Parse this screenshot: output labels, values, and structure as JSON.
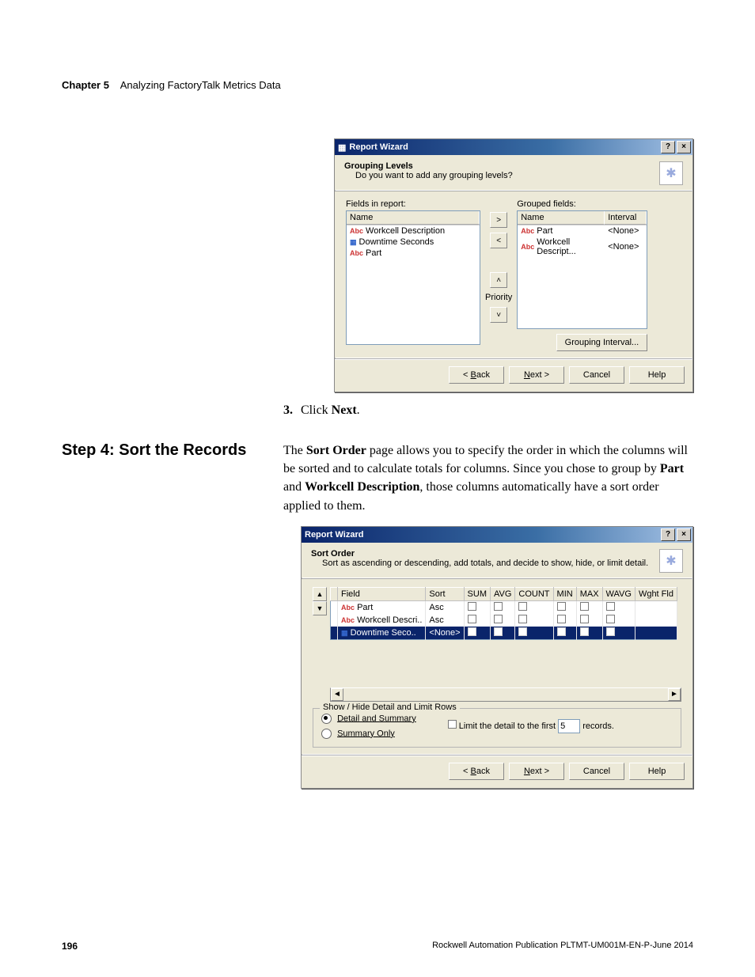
{
  "header": {
    "chapter": "Chapter 5",
    "title": "Analyzing FactoryTalk Metrics Data"
  },
  "section": {
    "number": "3.",
    "instruction_pre": "Click ",
    "instruction_bold": "Next",
    "instruction_post": "."
  },
  "step4": {
    "heading": "Step 4: Sort the Records",
    "para_parts": {
      "t1": "The ",
      "b1": "Sort Order",
      "t2": " page allows you to specify the order in which the columns will be sorted and to calculate totals for columns. Since you chose to group by ",
      "b2": "Part",
      "t3": " and ",
      "b3": "Workcell Description",
      "t4": ", those columns automatically have a sort order applied to them."
    }
  },
  "dlg1": {
    "title": "Report Wizard",
    "help_glyph": "?",
    "close_glyph": "×",
    "h1": "Grouping Levels",
    "sub": "Do you want to add any grouping levels?",
    "left_label": "Fields in report:",
    "left_header": "Name",
    "left_rows": [
      {
        "icon": "abc",
        "name": "Workcell Description"
      },
      {
        "icon": "num",
        "name": "Downtime Seconds"
      },
      {
        "icon": "abc",
        "name": "Part"
      }
    ],
    "right_label": "Grouped fields:",
    "right_headers": {
      "name": "Name",
      "interval": "Interval"
    },
    "right_rows": [
      {
        "icon": "abc",
        "name": "Part",
        "interval": "<None>"
      },
      {
        "icon": "abc",
        "name": "Workcell Descript...",
        "interval": "<None>"
      }
    ],
    "btn_right": ">",
    "btn_left": "<",
    "btn_up": "˄",
    "priority_label": "Priority",
    "btn_down": "˅",
    "grouping_interval": "Grouping Interval...",
    "footer": {
      "back": "< Back",
      "next": "Next >",
      "cancel": "Cancel",
      "help": "Help"
    }
  },
  "dlg2": {
    "title": "Report Wizard",
    "help_glyph": "?",
    "close_glyph": "×",
    "h1": "Sort Order",
    "sub": "Sort as ascending or descending, add totals, and decide to show, hide, or limit detail.",
    "spin_up": "▲",
    "spin_down": "▼",
    "cols": [
      "Field",
      "Sort",
      "SUM",
      "AVG",
      "COUNT",
      "MIN",
      "MAX",
      "WAVG",
      "Wght Fld"
    ],
    "rows": [
      {
        "icon": "abc",
        "field": "Part",
        "sort": "Asc",
        "sum": false,
        "avg": false,
        "count": false,
        "min": false,
        "max": false,
        "wavg": false,
        "sel": false
      },
      {
        "icon": "abc",
        "field": "Workcell Descri..",
        "sort": "Asc",
        "sum": false,
        "avg": false,
        "count": false,
        "min": false,
        "max": false,
        "wavg": false,
        "sel": false
      },
      {
        "icon": "num",
        "field": "Downtime Seco..",
        "sort": "<None>",
        "sum": false,
        "avg": true,
        "count": false,
        "min": false,
        "max": false,
        "wavg": false,
        "sel": true
      }
    ],
    "hscroll_left": "◄",
    "hscroll_right": "►",
    "fieldset_legend": "Show / Hide Detail and Limit Rows",
    "radio_detail": "Detail and Summary",
    "radio_summary": "Summary Only",
    "limit_checkbox_label_pre": "Limit the detail to the first",
    "limit_value": "5",
    "limit_checkbox_label_post": "records.",
    "footer": {
      "back": "< Back",
      "next": "Next >",
      "cancel": "Cancel",
      "help": "Help"
    }
  },
  "footer": {
    "page_number": "196",
    "publication": "Rockwell Automation Publication PLTMT-UM001M-EN-P-June 2014"
  }
}
